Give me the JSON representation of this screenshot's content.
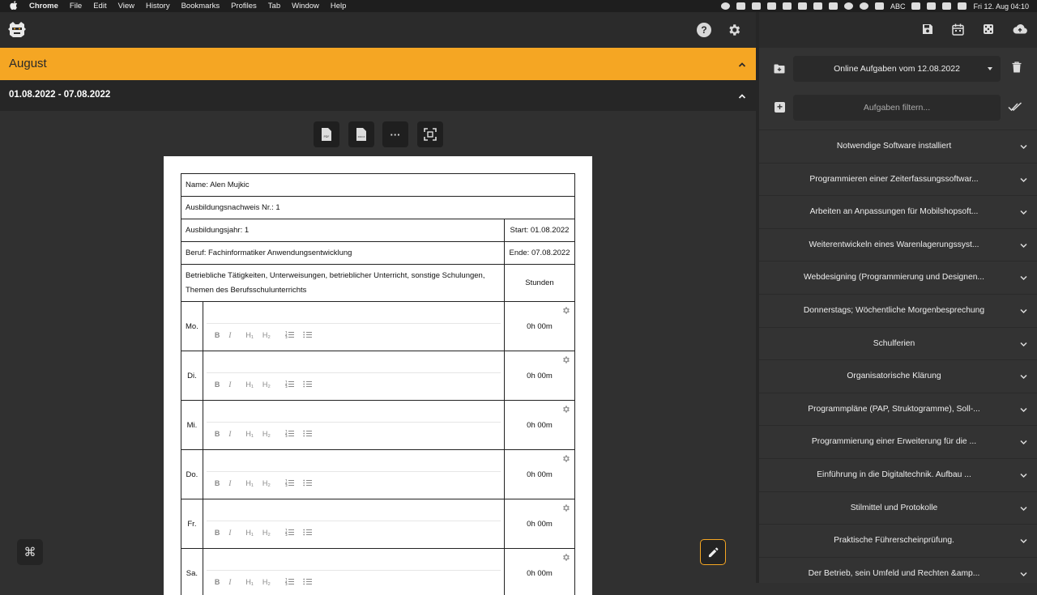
{
  "menubar": {
    "app_name": "Chrome",
    "items": [
      "File",
      "Edit",
      "View",
      "History",
      "Bookmarks",
      "Profiles",
      "Tab",
      "Window",
      "Help"
    ],
    "input_source": "ABC",
    "datetime": "Fri 12. Aug  04:10"
  },
  "month": {
    "title": "August"
  },
  "week": {
    "title": "01.08.2022 - 07.08.2022"
  },
  "toolbar": {
    "pdf_label": "PDF",
    "docx_label": "DOCX",
    "more_label": "···"
  },
  "report": {
    "name": "Name: Alen Mujkic",
    "nr": "Ausbildungsnachweis Nr.: 1",
    "year": "Ausbildungsjahr: 1",
    "start": "Start: 01.08.2022",
    "profession": "Beruf: Fachinformatiker Anwendungsentwicklung",
    "end": "Ende: 07.08.2022",
    "activities_header": "Betriebliche Tätigkeiten, Unterweisungen, betrieblicher Unterricht, sonstige Schulungen, Themen des Berufsschulunterrichts",
    "hours_header": "Stunden",
    "days": [
      {
        "label": "Mo.",
        "hours": "0h 00m"
      },
      {
        "label": "Di.",
        "hours": "0h 00m"
      },
      {
        "label": "Mi.",
        "hours": "0h 00m"
      },
      {
        "label": "Do.",
        "hours": "0h 00m"
      },
      {
        "label": "Fr.",
        "hours": "0h 00m"
      },
      {
        "label": "Sa.",
        "hours": "0h 00m"
      }
    ],
    "format_labels": {
      "bold": "B",
      "italic": "I",
      "h1": "H₁",
      "h2": "H₂"
    }
  },
  "right_panel": {
    "selected_task_list": "Online Aufgaben vom 12.08.2022",
    "filter_placeholder": "Aufgaben filtern...",
    "tasks": [
      "Notwendige Software installiert",
      "Programmieren einer Zeiterfassungssoftwar...",
      "Arbeiten an Anpassungen für Mobilshopsoft...",
      "Weiterentwickeln eines Warenlagerungssyst...",
      "Webdesigning (Programmierung und Designen...",
      "Donnerstags; Wöchentliche Morgenbesprechung",
      "Schulferien",
      "Organisatorische Klärung",
      "Programmpläne (PAP, Struktogramme), Soll-...",
      "Programmierung einer Erweiterung für die ...",
      "Einführung in die Digitaltechnik. Aufbau ...",
      "Stilmittel und Protokolle",
      "Praktische Führerscheinprüfung.",
      "Der Betrieb, sein Umfeld und Rechten &amp..."
    ]
  },
  "cmd_label": "⌘",
  "help_label": "?",
  "colors": {
    "accent": "#f5a623",
    "panel": "#333333",
    "bg": "#303030"
  }
}
